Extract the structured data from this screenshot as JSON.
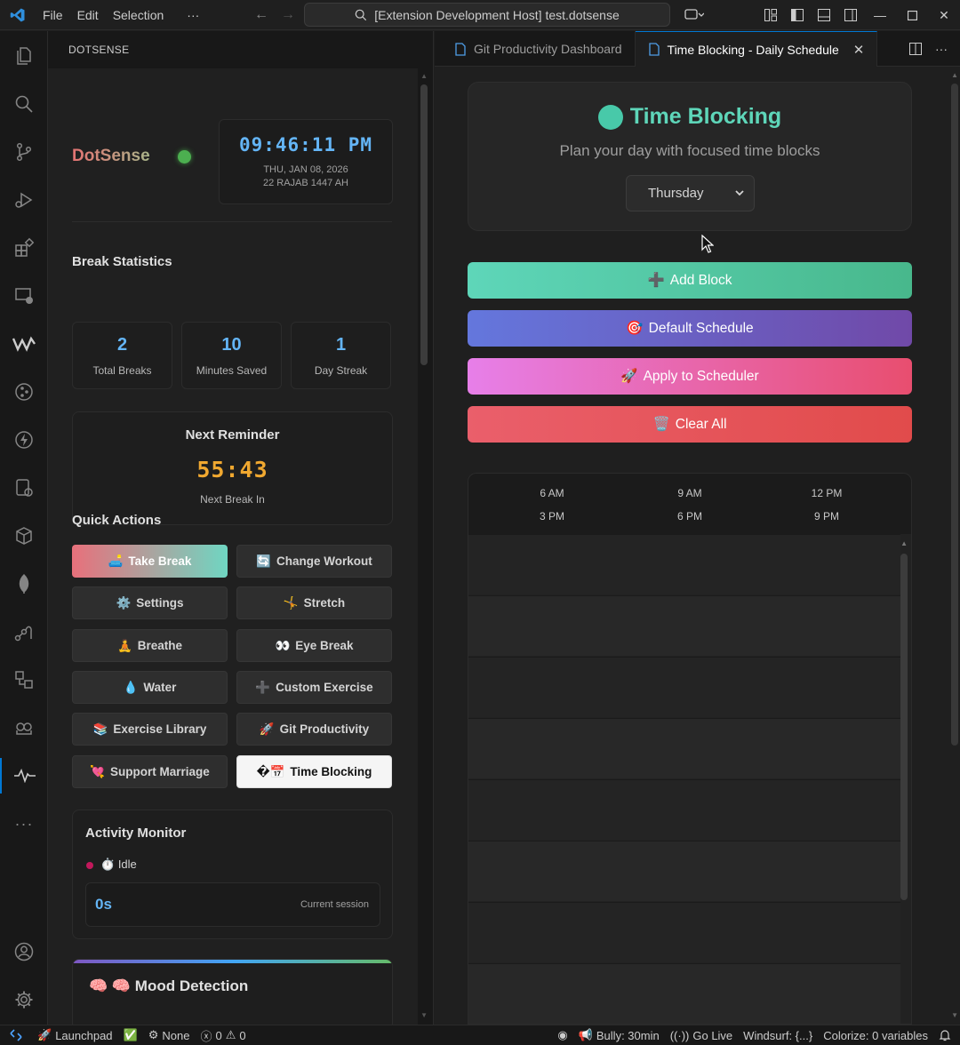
{
  "titlebar": {
    "menus": [
      "File",
      "Edit",
      "Selection",
      "···"
    ],
    "command_center": "[Extension Development Host] test.dotsense"
  },
  "sidebar": {
    "title": "DOTSENSE",
    "brand": "DotSense",
    "clock": {
      "time": "09:46:11 PM",
      "date": "THU, JAN 08, 2026",
      "hijri": "22 RAJAB 1447 AH"
    },
    "break_stats": {
      "title": "Break Statistics",
      "items": [
        {
          "value": "2",
          "label": "Total Breaks"
        },
        {
          "value": "10",
          "label": "Minutes Saved"
        },
        {
          "value": "1",
          "label": "Day Streak"
        }
      ]
    },
    "reminder": {
      "title": "Next Reminder",
      "time": "55:43",
      "label": "Next Break In"
    },
    "quick_actions": {
      "title": "Quick Actions",
      "buttons": [
        {
          "icon": "🛋️",
          "label": "Take Break"
        },
        {
          "icon": "🔄",
          "label": "Change Workout"
        },
        {
          "icon": "⚙️",
          "label": "Settings"
        },
        {
          "icon": "🤸",
          "label": "Stretch"
        },
        {
          "icon": "🧘",
          "label": "Breathe"
        },
        {
          "icon": "👀",
          "label": "Eye Break"
        },
        {
          "icon": "💧",
          "label": "Water"
        },
        {
          "icon": "➕",
          "label": "Custom Exercise"
        },
        {
          "icon": "📚",
          "label": "Exercise Library"
        },
        {
          "icon": "🚀",
          "label": "Git Productivity"
        },
        {
          "icon": "💘",
          "label": "Support Marriage"
        },
        {
          "icon": "�📅",
          "label": "Time Blocking"
        }
      ]
    },
    "activity": {
      "title": "Activity Monitor",
      "status_icon": "⏱️",
      "status": "Idle",
      "session_value": "0s",
      "session_label": "Current session"
    },
    "mood": {
      "icon": "🧠",
      "title": "🧠 Mood Detection"
    }
  },
  "tabs": [
    {
      "label": "Git Productivity Dashboard",
      "active": false
    },
    {
      "label": "Time Blocking - Daily Schedule",
      "active": true
    }
  ],
  "editor": {
    "title": "Time Blocking",
    "subtitle": "Plan your day with focused time blocks",
    "day_select": "Thursday",
    "buttons": {
      "add": {
        "icon": "➕",
        "label": "Add Block"
      },
      "default": {
        "icon": "🎯",
        "label": "Default Schedule"
      },
      "apply": {
        "icon": "🚀",
        "label": "Apply to Scheduler"
      },
      "clear": {
        "icon": "🗑️",
        "label": "Clear All"
      }
    },
    "hours_row1": [
      "6 AM",
      "9 AM",
      "12 PM"
    ],
    "hours_row2": [
      "3 PM",
      "6 PM",
      "9 PM"
    ]
  },
  "statusbar": {
    "launchpad": "Launchpad",
    "none": "None",
    "errors": "0",
    "warnings": "0",
    "bully": "Bully: 30min",
    "golive": "Go Live",
    "windsurf": "Windsurf: {...}",
    "colorize": "Colorize: 0 variables"
  },
  "colors": {
    "accent": "#0078d4",
    "teal": "#5ed6b9",
    "clock_blue": "#64b5f6",
    "timer_orange": "#f0a830"
  }
}
